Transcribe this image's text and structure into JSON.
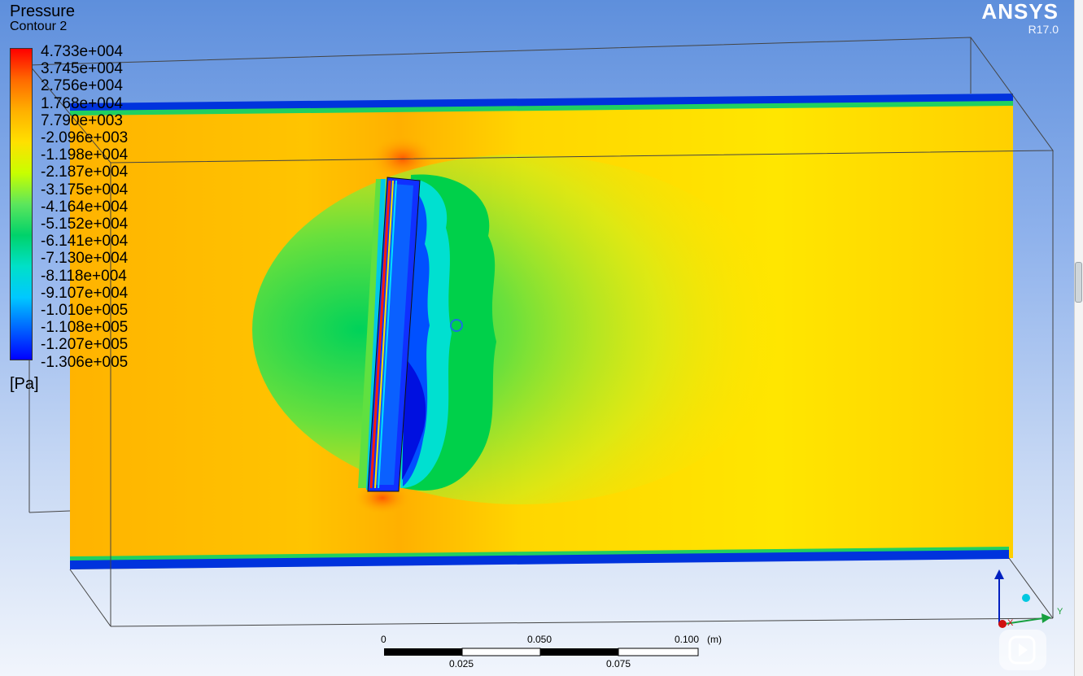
{
  "legend": {
    "title": "Pressure",
    "subtitle": "Contour 2",
    "unit": "[Pa]",
    "values": [
      "4.733e+004",
      "3.745e+004",
      "2.756e+004",
      "1.768e+004",
      "7.790e+003",
      "-2.096e+003",
      "-1.198e+004",
      "-2.187e+004",
      "-3.175e+004",
      "-4.164e+004",
      "-5.152e+004",
      "-6.141e+004",
      "-7.130e+004",
      "-8.118e+004",
      "-9.107e+004",
      "-1.010e+005",
      "-1.108e+005",
      "-1.207e+005",
      "-1.306e+005"
    ],
    "colors": [
      "#ff0000",
      "#ff6a00",
      "#ffb000",
      "#ffe000",
      "#c8ff00",
      "#5ce65c",
      "#00d26a",
      "#00e0c8",
      "#00c8ff",
      "#0064ff",
      "#0000ff"
    ]
  },
  "brand": {
    "name": "ANSYS",
    "version": "R17.0"
  },
  "scale_bar": {
    "top_labels": [
      "0",
      "0.050",
      "0.100"
    ],
    "unit": "(m)",
    "bottom_labels": [
      "0.025",
      "0.075"
    ]
  },
  "axes": {
    "y_label": "Y",
    "x_label": "X"
  },
  "colors": {
    "background_top": "#5e8fdc",
    "background_bottom": "#f1f5fc",
    "field_main": "#ffc400",
    "wall_band": "#0033cc"
  }
}
